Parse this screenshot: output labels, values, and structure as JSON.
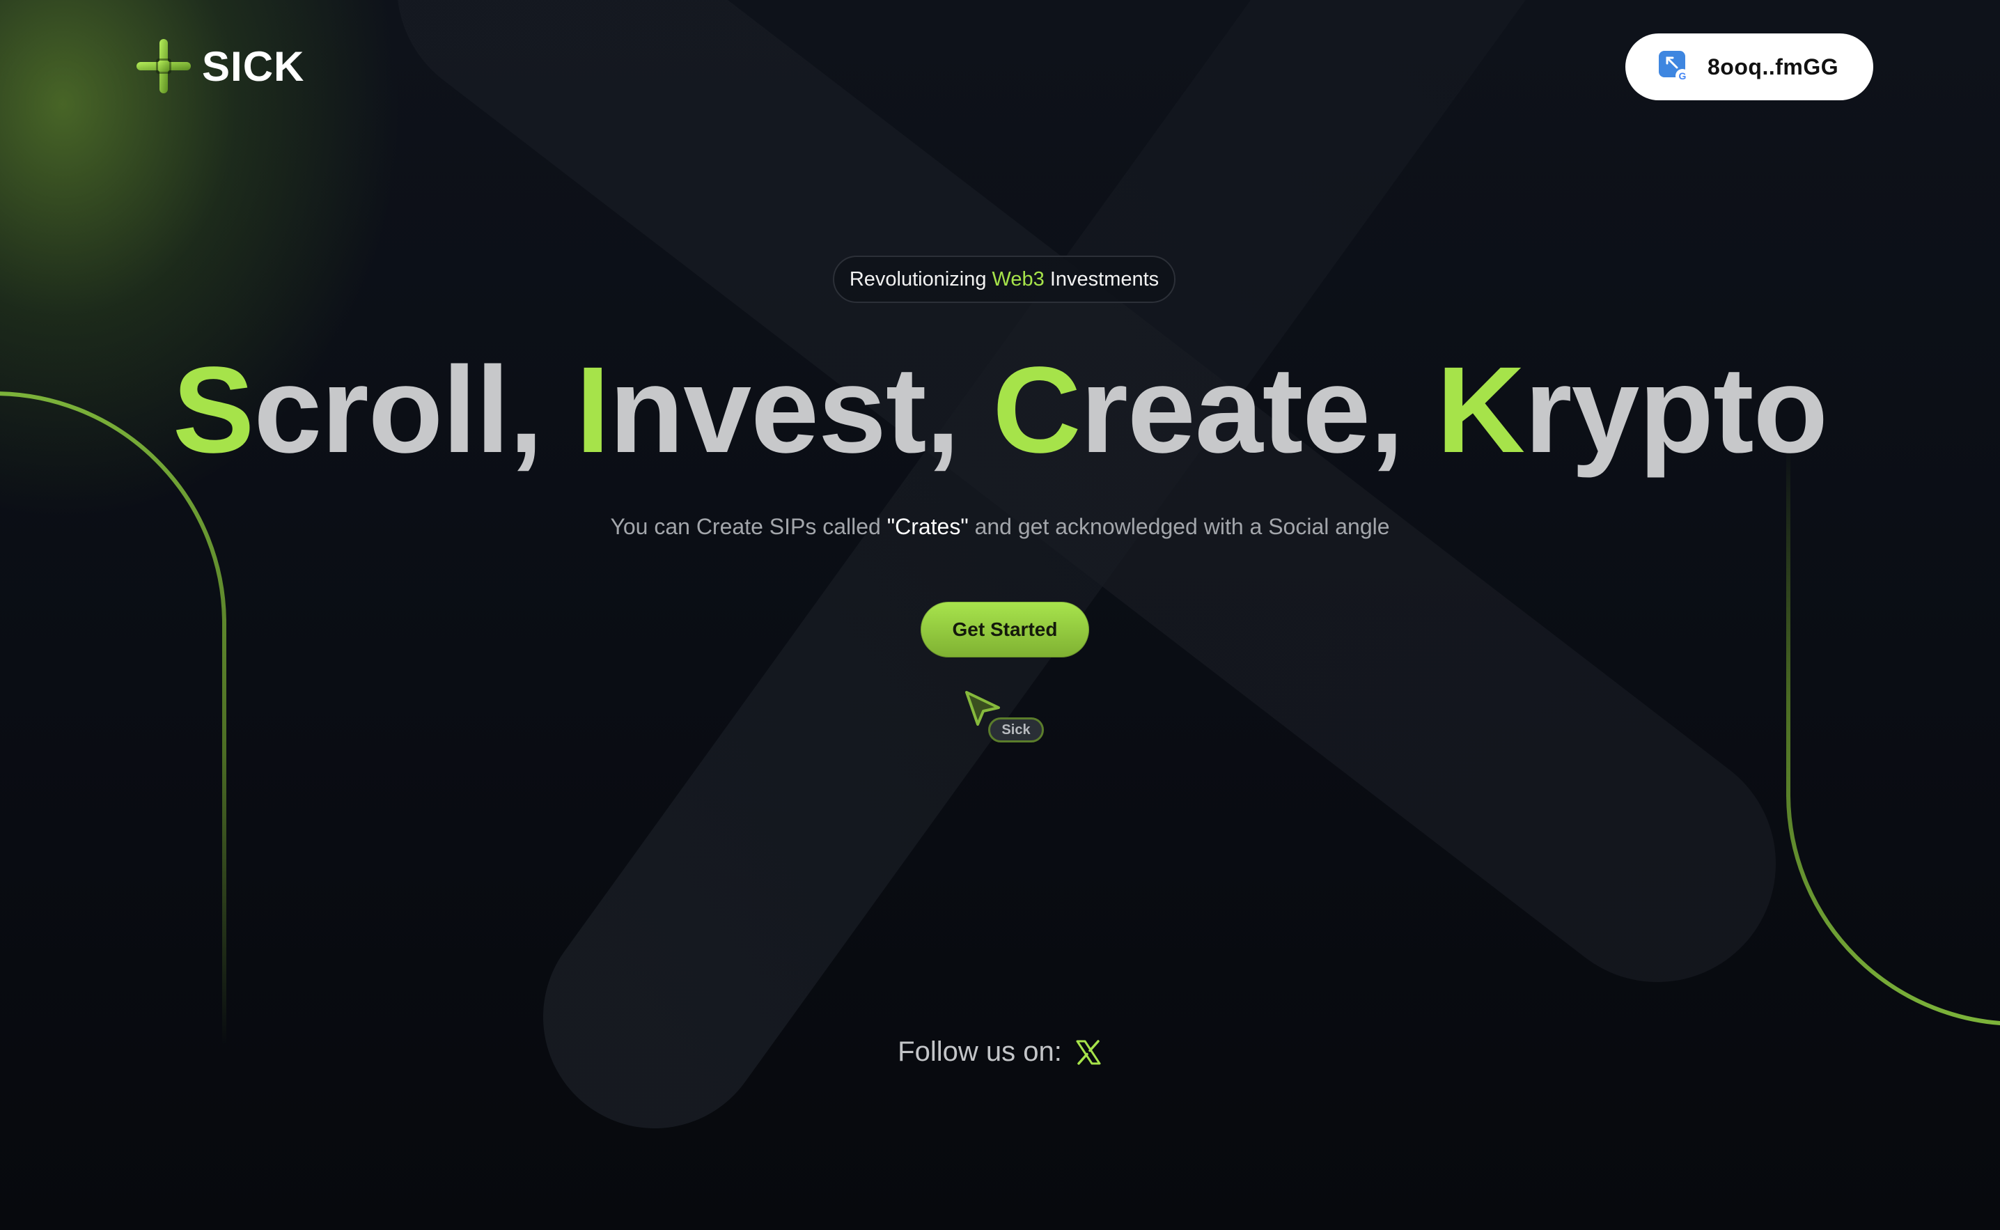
{
  "header": {
    "logo_text": "SICK",
    "logo_icon": "plus-mark-icon",
    "wallet": {
      "address": "8ooq..fmGG",
      "icon": "google-wallet-icon"
    }
  },
  "hero": {
    "badge": {
      "prefix": "Revolutionizing ",
      "highlight": "Web3",
      "suffix": " Investments"
    },
    "headline": [
      {
        "initial": "S",
        "rest": "croll, "
      },
      {
        "initial": "I",
        "rest": "nvest, "
      },
      {
        "initial": "C",
        "rest": "reate, "
      },
      {
        "initial": "K",
        "rest": "rypto"
      }
    ],
    "subtitle": {
      "prefix": "You can Create SIPs called ",
      "highlight": "\"Crates\"",
      "suffix": " and get acknowledged with a Social angle"
    },
    "cta_label": "Get Started",
    "cursor_tag": "Sick"
  },
  "footer": {
    "follow_label": "Follow us on:",
    "social_icon": "x-twitter-icon"
  },
  "colors": {
    "accent": "#a6e34a",
    "background": "#0b0e14",
    "headline_gray": "#c7c8ca"
  }
}
